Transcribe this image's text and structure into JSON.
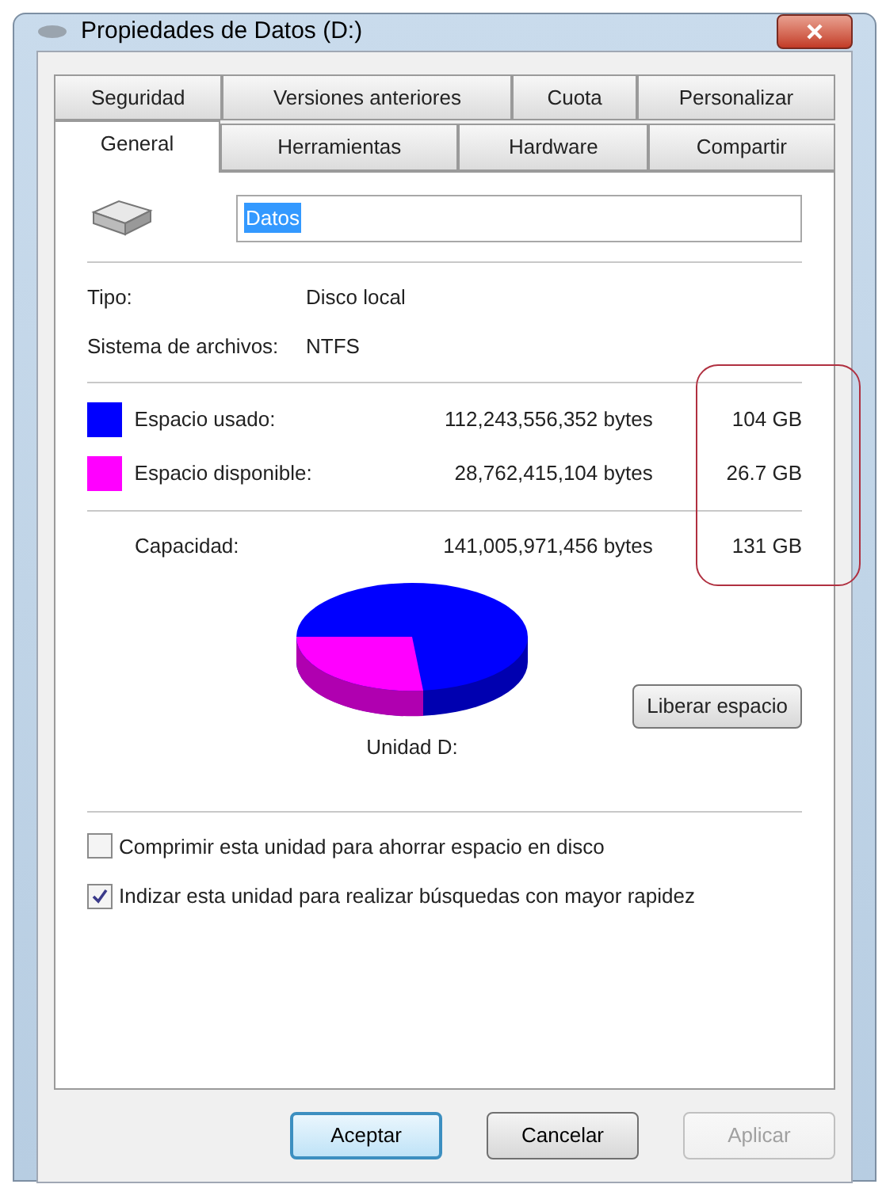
{
  "window": {
    "title": "Propiedades de Datos (D:)"
  },
  "tab_rows": [
    [
      {
        "label": "Seguridad",
        "selected": false
      },
      {
        "label": "Versiones anteriores",
        "selected": false
      },
      {
        "label": "Cuota",
        "selected": false
      },
      {
        "label": "Personalizar",
        "selected": false
      }
    ],
    [
      {
        "label": "General",
        "selected": true
      },
      {
        "label": "Herramientas",
        "selected": false
      },
      {
        "label": "Hardware",
        "selected": false
      },
      {
        "label": "Compartir",
        "selected": false
      }
    ]
  ],
  "name_field": {
    "value": "Datos"
  },
  "info": [
    {
      "label": "Tipo:",
      "value": "Disco local"
    },
    {
      "label": "Sistema de archivos:",
      "value": "NTFS"
    }
  ],
  "space": [
    {
      "label": "Espacio usado:",
      "bytes": "112,243,556,352 bytes",
      "size": "104 GB",
      "color": "#0000ff"
    },
    {
      "label": "Espacio disponible:",
      "bytes": "28,762,415,104 bytes",
      "size": "26.7 GB",
      "color": "#ff00ff"
    }
  ],
  "capacity": {
    "label": "Capacidad:",
    "bytes": "141,005,971,456 bytes",
    "size": "131 GB"
  },
  "drive_label": "Unidad D:",
  "cleanup_button": "Liberar espacio",
  "options": [
    {
      "label": "Comprimir esta unidad para ahorrar espacio en disco",
      "checked": false
    },
    {
      "label": "Indizar esta unidad para realizar búsquedas con mayor rapidez",
      "checked": true
    }
  ],
  "buttons": [
    {
      "label": "Aceptar",
      "default": true,
      "disabled": false
    },
    {
      "label": "Cancelar",
      "default": false,
      "disabled": false
    },
    {
      "label": "Aplicar",
      "default": false,
      "disabled": true
    }
  ]
}
